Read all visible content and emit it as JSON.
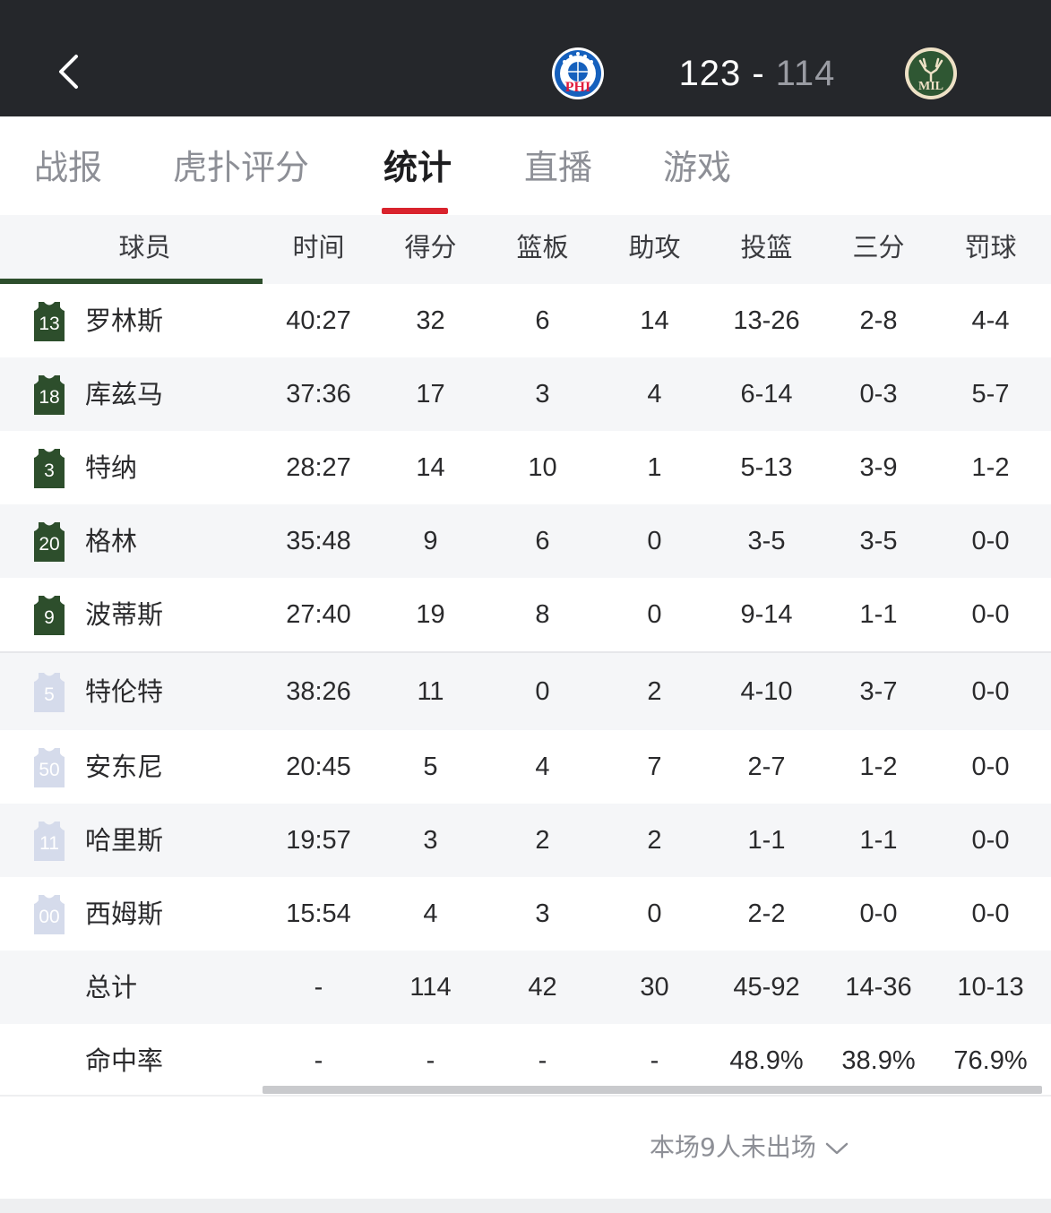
{
  "header": {
    "home_score": "123",
    "dash": "-",
    "away_score": "114",
    "home_logo_text": "PHI",
    "away_logo_text": "MIL"
  },
  "tabs": [
    {
      "label": "战报"
    },
    {
      "label": "虎扑评分"
    },
    {
      "label": "统计",
      "active": true
    },
    {
      "label": "直播"
    },
    {
      "label": "游戏"
    }
  ],
  "columns": [
    "球员",
    "时间",
    "得分",
    "篮板",
    "助攻",
    "投篮",
    "三分",
    "罚球"
  ],
  "players": [
    {
      "jersey": "13",
      "name": "罗林斯",
      "min": "40:27",
      "pts": "32",
      "reb": "6",
      "ast": "14",
      "fg": "13-26",
      "tp": "2-8",
      "ft": "4-4",
      "starter": true
    },
    {
      "jersey": "18",
      "name": "库兹马",
      "min": "37:36",
      "pts": "17",
      "reb": "3",
      "ast": "4",
      "fg": "6-14",
      "tp": "0-3",
      "ft": "5-7",
      "starter": true
    },
    {
      "jersey": "3",
      "name": "特纳",
      "min": "28:27",
      "pts": "14",
      "reb": "10",
      "ast": "1",
      "fg": "5-13",
      "tp": "3-9",
      "ft": "1-2",
      "starter": true
    },
    {
      "jersey": "20",
      "name": "格林",
      "min": "35:48",
      "pts": "9",
      "reb": "6",
      "ast": "0",
      "fg": "3-5",
      "tp": "3-5",
      "ft": "0-0",
      "starter": true
    },
    {
      "jersey": "9",
      "name": "波蒂斯",
      "min": "27:40",
      "pts": "19",
      "reb": "8",
      "ast": "0",
      "fg": "9-14",
      "tp": "1-1",
      "ft": "0-0",
      "starter": true
    },
    {
      "jersey": "5",
      "name": "特伦特",
      "min": "38:26",
      "pts": "11",
      "reb": "0",
      "ast": "2",
      "fg": "4-10",
      "tp": "3-7",
      "ft": "0-0",
      "starter": false
    },
    {
      "jersey": "50",
      "name": "安东尼",
      "min": "20:45",
      "pts": "5",
      "reb": "4",
      "ast": "7",
      "fg": "2-7",
      "tp": "1-2",
      "ft": "0-0",
      "starter": false
    },
    {
      "jersey": "11",
      "name": "哈里斯",
      "min": "19:57",
      "pts": "3",
      "reb": "2",
      "ast": "2",
      "fg": "1-1",
      "tp": "1-1",
      "ft": "0-0",
      "starter": false
    },
    {
      "jersey": "00",
      "name": "西姆斯",
      "min": "15:54",
      "pts": "4",
      "reb": "3",
      "ast": "0",
      "fg": "2-2",
      "tp": "0-0",
      "ft": "0-0",
      "starter": false
    }
  ],
  "totals": {
    "label": "总计",
    "min": "-",
    "pts": "114",
    "reb": "42",
    "ast": "30",
    "fg": "45-92",
    "tp": "14-36",
    "ft": "10-13"
  },
  "percentages": {
    "label": "命中率",
    "min": "-",
    "pts": "-",
    "reb": "-",
    "ast": "-",
    "fg": "48.9%",
    "tp": "38.9%",
    "ft": "76.9%"
  },
  "footer": {
    "dnp_text": "本场9人未出场"
  },
  "colors": {
    "header_bg": "#25272b",
    "tab_accent": "#d9232d",
    "starter_jersey": "#2d4e2c",
    "bench_jersey": "#d5dbeb"
  }
}
